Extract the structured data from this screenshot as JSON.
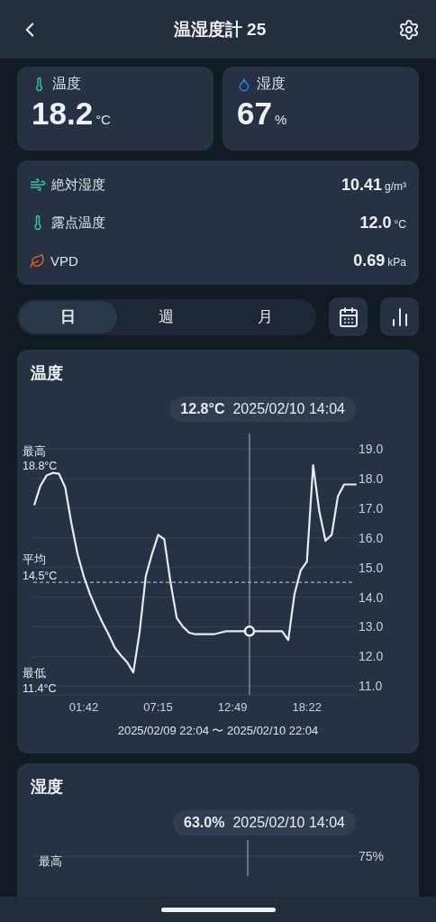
{
  "header": {
    "title": "温湿度計 25"
  },
  "summary": [
    {
      "kind": "temperature",
      "label": "温度",
      "value": "18.2",
      "unit": "°C"
    },
    {
      "kind": "humidity",
      "label": "湿度",
      "value": "67",
      "unit": "%"
    }
  ],
  "details": [
    {
      "kind": "absolute",
      "label": "絶対湿度",
      "value": "10.41",
      "unit": "g/m³"
    },
    {
      "kind": "dewpoint",
      "label": "露点温度",
      "value": "12.0",
      "unit": "°C"
    },
    {
      "kind": "vpd",
      "label": "VPD",
      "value": "0.69",
      "unit": "kPa"
    }
  ],
  "period_tabs": [
    {
      "label": "日",
      "selected": true
    },
    {
      "label": "週",
      "selected": false
    },
    {
      "label": "月",
      "selected": false
    }
  ],
  "temperature_card": {
    "title": "温度",
    "tooltip_value": "12.8°C",
    "tooltip_time": "2025/02/10 14:04",
    "max_label": "最高",
    "max_value": "18.8°C",
    "avg_label": "平均",
    "avg_value": "14.5°C",
    "min_label": "最低",
    "min_value": "11.4°C",
    "range": "2025/02/09 22:04 〜 2025/02/10 22:04",
    "chart_data": {
      "type": "line",
      "ylim": [
        10.7,
        19.6
      ],
      "grid": true,
      "categories": [
        null,
        null,
        null,
        null,
        null,
        null,
        null,
        null,
        "01:42",
        null,
        null,
        null,
        null,
        null,
        null,
        null,
        null,
        null,
        null,
        null,
        "07:15",
        null,
        null,
        null,
        null,
        null,
        null,
        null,
        null,
        null,
        null,
        null,
        "12:49",
        null,
        null,
        null,
        null,
        null,
        null,
        null,
        null,
        null,
        null,
        null,
        "18:22",
        null,
        null,
        null,
        null,
        null,
        null,
        null,
        null
      ],
      "series": [
        {
          "color": "#e8ecf0",
          "values": [
            17.1,
            17.75,
            18.1,
            18.19,
            18.16,
            17.7,
            16.5,
            15.45,
            14.7,
            14.1,
            13.6,
            13.15,
            12.75,
            12.3,
            12.03,
            11.8,
            11.46,
            12.8,
            14.7,
            15.45,
            16.1,
            15.95,
            14.5,
            13.3,
            13.0,
            12.8,
            12.75,
            12.75,
            12.75,
            12.75,
            12.8,
            12.85,
            12.85,
            12.85,
            12.85,
            12.85,
            12.85,
            12.85,
            12.85,
            12.85,
            12.85,
            12.55,
            14.1,
            14.9,
            15.2,
            18.45,
            16.9,
            15.9,
            16.1,
            17.4,
            17.8,
            17.8,
            17.8
          ]
        }
      ],
      "yticks": [
        {
          "value": 19,
          "label": "19.0"
        },
        {
          "value": 18,
          "label": "18.0"
        },
        {
          "value": 17,
          "label": "17.0"
        },
        {
          "value": 16,
          "label": "16.0"
        },
        {
          "value": 15,
          "label": "15.0"
        },
        {
          "value": 14,
          "label": "14.0"
        },
        {
          "value": 13,
          "label": "13.0"
        },
        {
          "value": 12,
          "label": "12.0"
        },
        {
          "value": 11,
          "label": "11.0"
        }
      ],
      "ref_lines": [
        {
          "axis": "y",
          "value": 14.5
        }
      ]
    }
  },
  "humidity_card": {
    "title": "湿度",
    "tooltip_value": "63.0%",
    "tooltip_time": "2025/02/10 14:04",
    "max_label": "最高",
    "top_tick": "75%"
  }
}
